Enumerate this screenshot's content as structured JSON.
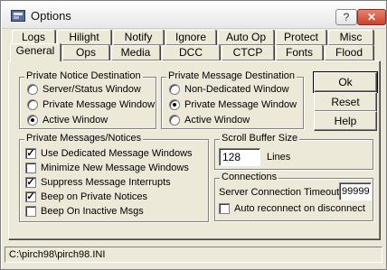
{
  "window": {
    "title": "Options"
  },
  "titlebar": {
    "help_glyph": "?",
    "close_glyph": "✕"
  },
  "tabs": {
    "row1": [
      "Logs",
      "Hilight",
      "Notify",
      "Ignore",
      "Auto Op",
      "Protect",
      "Misc"
    ],
    "row2": [
      "General",
      "Ops",
      "Media",
      "DCC",
      "CTCP",
      "Fonts",
      "Flood"
    ],
    "active": "General"
  },
  "private_notice": {
    "legend": "Private Notice Destination",
    "options": [
      "Server/Status Window",
      "Private Message Window",
      "Active Window"
    ],
    "selected": "Active Window"
  },
  "private_message": {
    "legend": "Private Message Destination",
    "options": [
      "Non-Dedicated Window",
      "Private Message Window",
      "Active Window"
    ],
    "selected": "Private Message Window"
  },
  "messages_notices": {
    "legend": "Private Messages/Notices",
    "items": [
      {
        "label": "Use Dedicated Message Windows",
        "checked": true
      },
      {
        "label": "Minimize New Message Windows",
        "checked": false
      },
      {
        "label": "Suppress Message Interrupts",
        "checked": true
      },
      {
        "label": "Beep on Private Notices",
        "checked": true
      },
      {
        "label": "Beep On Inactive Msgs",
        "checked": false
      }
    ]
  },
  "scroll_buffer": {
    "legend": "Scroll Buffer Size",
    "value": "128",
    "unit": "Lines"
  },
  "connections": {
    "legend": "Connections",
    "timeout_label": "Server Connection Timeout",
    "timeout_value": "99999",
    "auto_reconnect_label": "Auto reconnect on disconnect",
    "auto_reconnect_checked": false
  },
  "buttons": {
    "ok": "Ok",
    "reset": "Reset",
    "help": "Help"
  },
  "status": {
    "path": "C:\\pirch98\\pirch98.INI"
  }
}
